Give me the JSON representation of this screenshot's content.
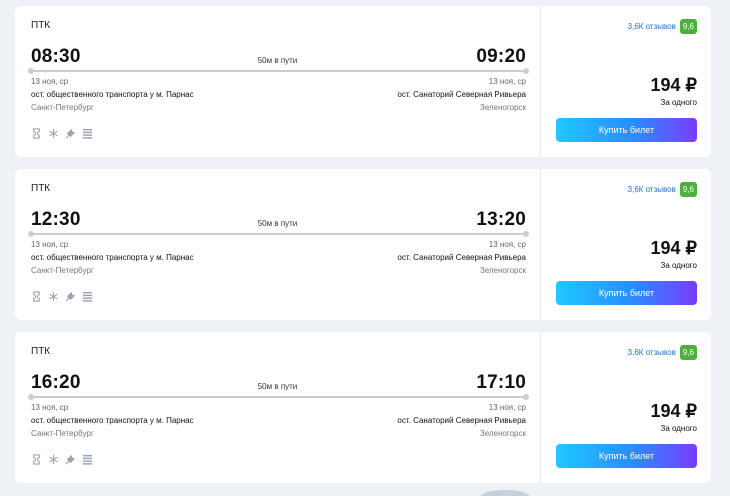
{
  "colors": {
    "accent_gradient": [
      "#1fc8ff",
      "#2a8cff",
      "#7b3bff"
    ],
    "rating_badge": "#4caf3e",
    "link": "#1a73d9",
    "page_bg": "#eef1f5"
  },
  "amenity_icons": [
    "ticket-icon",
    "snowflake-icon",
    "usb-charger-icon",
    "seat-icon"
  ],
  "trips": [
    {
      "carrier": "ПТК",
      "departure_time": "08:30",
      "arrival_time": "09:20",
      "duration": "50м в пути",
      "departure_date": "13 ноя, ср",
      "arrival_date": "13 ноя, ср",
      "departure_stop": "ост. общественного транспорта у м. Парнас",
      "arrival_stop": "ост. Санаторий Северная Ривьера",
      "departure_city": "Санкт-Петербург",
      "arrival_city": "Зеленогорск",
      "reviews": "3,6К отзывов",
      "rating": "9,6",
      "price": "194 ₽",
      "price_note": "За одного",
      "buy_label": "Купить билет"
    },
    {
      "carrier": "ПТК",
      "departure_time": "12:30",
      "arrival_time": "13:20",
      "duration": "50м в пути",
      "departure_date": "13 ноя, ср",
      "arrival_date": "13 ноя, ср",
      "departure_stop": "ост. общественного транспорта у м. Парнас",
      "arrival_stop": "ост. Санаторий Северная Ривьера",
      "departure_city": "Санкт-Петербург",
      "arrival_city": "Зеленогорск",
      "reviews": "3,6К отзывов",
      "rating": "9,6",
      "price": "194 ₽",
      "price_note": "За одного",
      "buy_label": "Купить билет"
    },
    {
      "carrier": "ПТК",
      "departure_time": "16:20",
      "arrival_time": "17:10",
      "duration": "50м в пути",
      "departure_date": "13 ноя, ср",
      "arrival_date": "13 ноя, ср",
      "departure_stop": "ост. общественного транспорта у м. Парнас",
      "arrival_stop": "ост. Санаторий Северная Ривьера",
      "departure_city": "Санкт-Петербург",
      "arrival_city": "Зеленогорск",
      "reviews": "3,6К отзывов",
      "rating": "9,6",
      "price": "194 ₽",
      "price_note": "За одного",
      "buy_label": "Купить билет"
    }
  ]
}
